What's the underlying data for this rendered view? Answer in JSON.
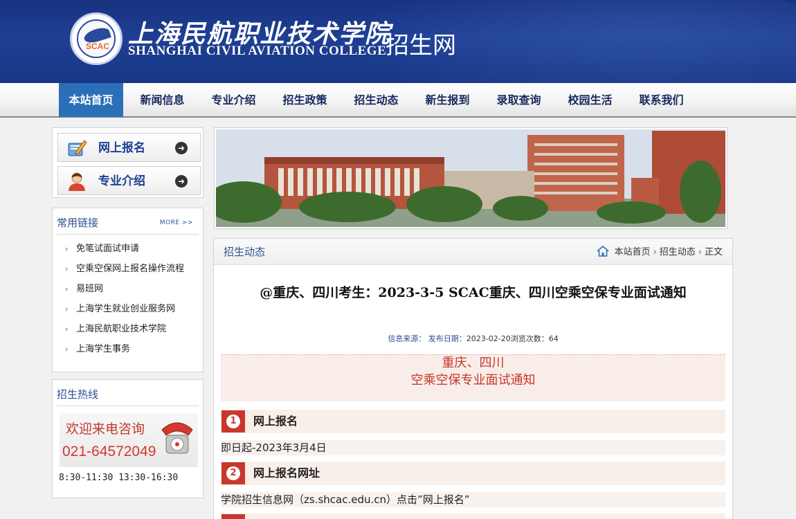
{
  "header": {
    "logo_text": "SCAC",
    "college_name_cn": "上海民航职业技术学院",
    "college_name_en": "SHANGHAI CIVIL AVIATION COLLEGE",
    "site_name": "招生网"
  },
  "nav": {
    "items": [
      "本站首页",
      "新闻信息",
      "专业介绍",
      "招生政策",
      "招生动态",
      "新生报到",
      "录取查询",
      "校园生活",
      "联系我们"
    ],
    "active": "本站首页"
  },
  "quick_buttons": [
    {
      "label": "网上报名",
      "icon": "pencil-notebook-icon"
    },
    {
      "label": "专业介绍",
      "icon": "attendant-avatar-icon"
    }
  ],
  "links": {
    "title": "常用链接",
    "more": "MORE >>",
    "items": [
      "免笔试面试申请",
      "空乘空保网上报名操作流程",
      "易班网",
      "上海学生就业创业服务网",
      "上海民航职业技术学院",
      "上海学生事务"
    ]
  },
  "hotline": {
    "title": "招生热线",
    "welcome": "欢迎来电咨询",
    "phone": "021-64572049",
    "hours": "8:30-11:30 13:30-16:30"
  },
  "article": {
    "category": "招生动态",
    "breadcrumb": [
      "本站首页",
      "招生动态",
      "正文"
    ],
    "title": "@重庆、四川考生：2023-3-5 SCAC重庆、四川空乘空保专业面试通知",
    "meta": {
      "source_label": "信息来源：",
      "date_label": "发布日期：",
      "date": "2023-02-20",
      "views_label": "浏览次数：",
      "views": "64"
    },
    "notice_lines": [
      "重庆、四川",
      "空乘空保专业面试通知"
    ],
    "sections": [
      {
        "num": "1",
        "label": "网上报名",
        "body": "即日起-2023年3月4日"
      },
      {
        "num": "2",
        "label": "网上报名网址",
        "body": "学院招生信息网（zs.shcac.edu.cn）点击”网上报名”"
      }
    ]
  },
  "colors": {
    "header_blue": "#1e3f95",
    "nav_active": "#2c6fb9",
    "accent_red": "#c9372c"
  }
}
